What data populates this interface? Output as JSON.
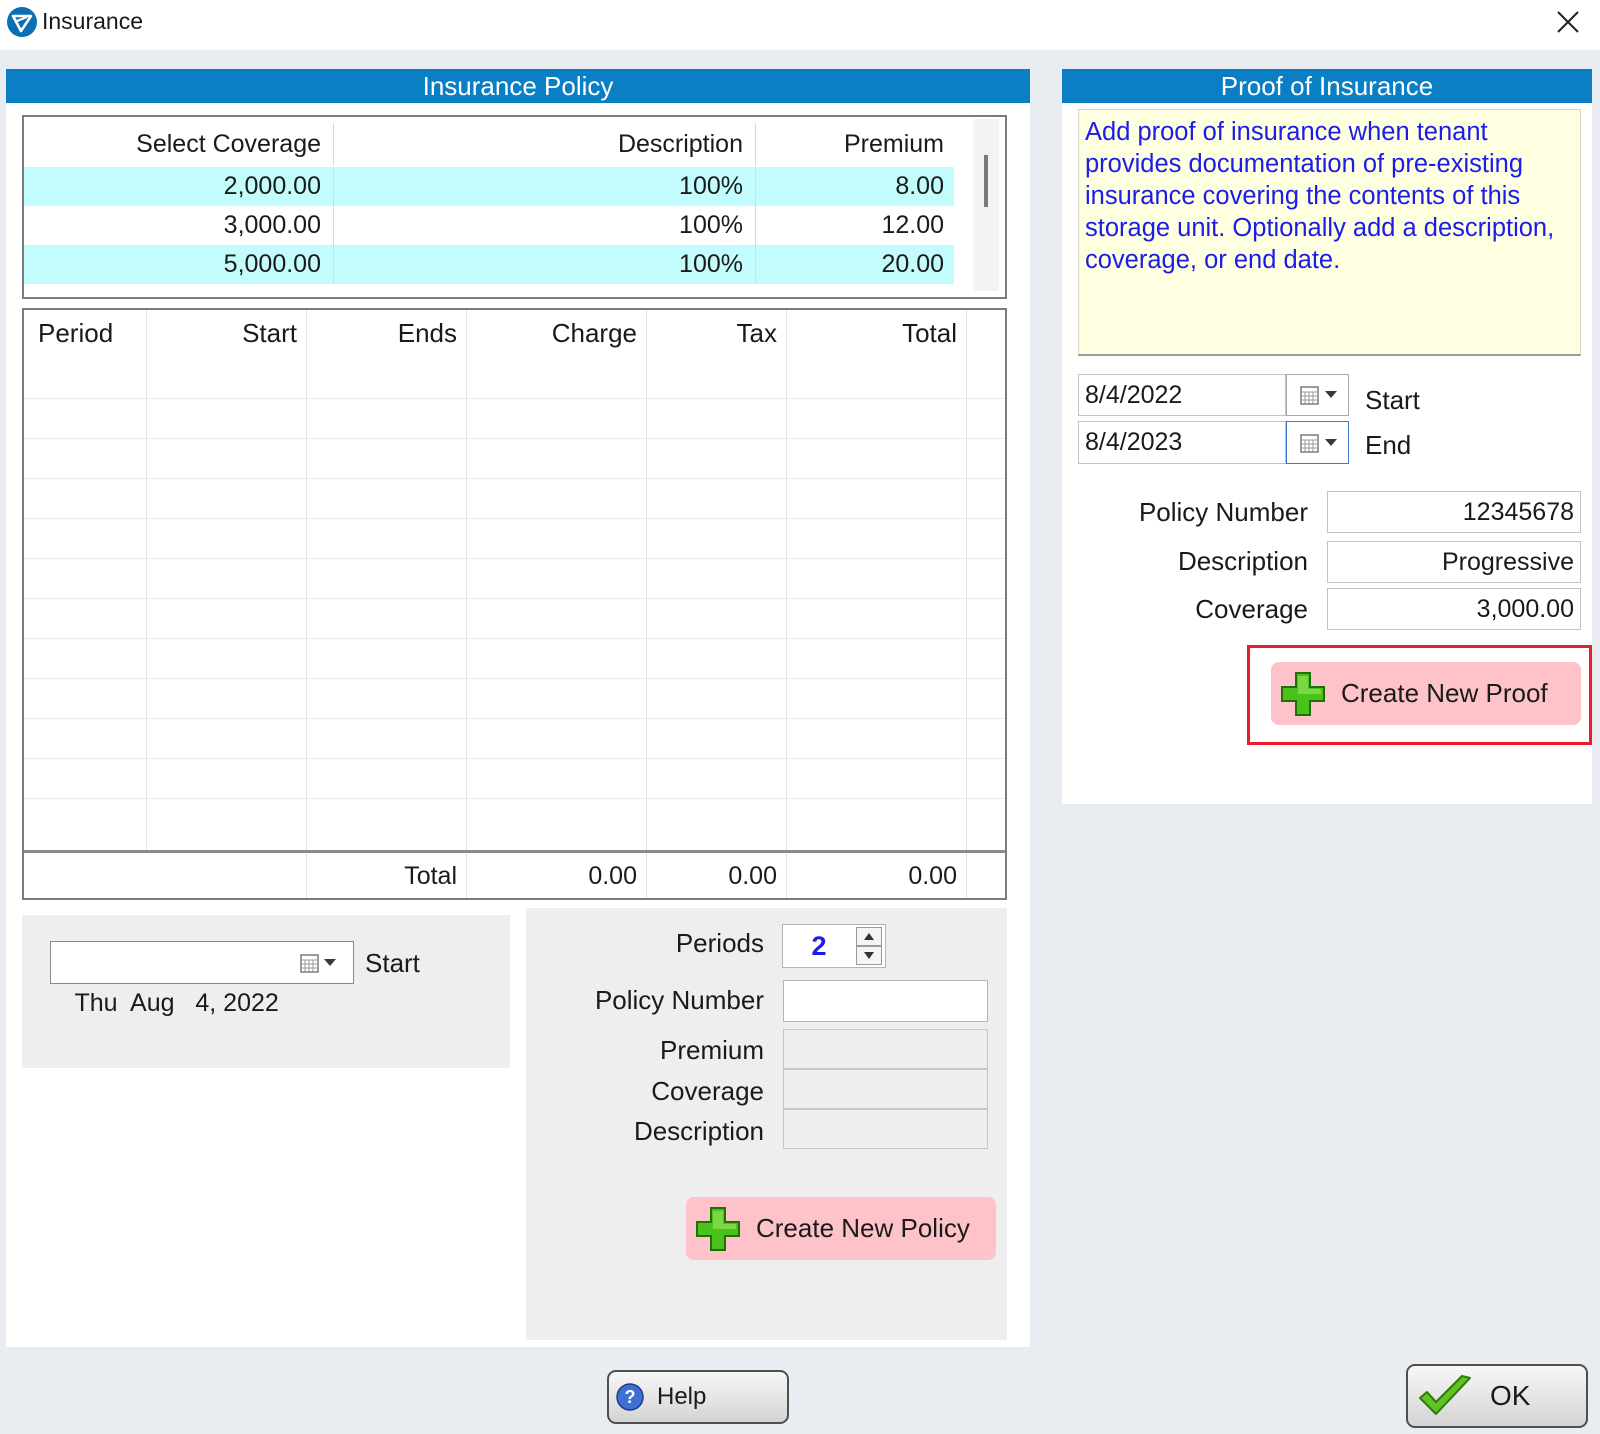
{
  "window": {
    "title": "Insurance"
  },
  "policy_section": {
    "header": "Insurance Policy",
    "coverage_table": {
      "columns": [
        "Select Coverage",
        "Description",
        "Premium"
      ],
      "rows": [
        [
          "2,000.00",
          "100%",
          "8.00"
        ],
        [
          "3,000.00",
          "100%",
          "12.00"
        ],
        [
          "5,000.00",
          "100%",
          "20.00"
        ]
      ]
    },
    "period_table": {
      "columns": [
        "Period",
        "Start",
        "Ends",
        "Charge",
        "Tax",
        "Total"
      ],
      "totals": {
        "label": "Total",
        "charge": "0.00",
        "tax": "0.00",
        "total": "0.00"
      }
    },
    "start_date": {
      "value": "Thu  Aug   4, 2022",
      "label": "Start"
    },
    "form": {
      "periods_label": "Periods",
      "periods_value": "2",
      "policy_number_label": "Policy Number",
      "policy_number_value": "",
      "premium_label": "Premium",
      "coverage_label": "Coverage",
      "description_label": "Description",
      "create_button": "Create New Policy"
    }
  },
  "proof_section": {
    "header": "Proof of Insurance",
    "note": "Add proof of insurance when tenant provides documentation of pre-existing insurance covering the contents of this storage unit.  Optionally add a description, coverage, or end date.",
    "start": {
      "value": "8/4/2022",
      "label": "Start"
    },
    "end": {
      "value": "8/4/2023",
      "label": "End"
    },
    "policy_number": {
      "label": "Policy Number",
      "value": "12345678"
    },
    "description": {
      "label": "Description",
      "value": "Progressive"
    },
    "coverage": {
      "label": "Coverage",
      "value": "3,000.00"
    },
    "create_button": "Create New Proof"
  },
  "footer": {
    "help_button": "Help",
    "ok_button": "OK"
  },
  "colors": {
    "header_blue": "#0a7fc3",
    "row_highlight": "#c3fcfd",
    "note_bg": "#fefee0",
    "note_text": "#1c1ce8",
    "pink_button": "#fec3c9",
    "highlight_red": "#ea1d2c"
  },
  "icons": [
    "app-logo-icon",
    "close-icon",
    "calendar-icon",
    "dropdown-arrow-icon",
    "spinner-up-icon",
    "spinner-down-icon",
    "plus-icon",
    "help-icon",
    "checkmark-icon"
  ]
}
